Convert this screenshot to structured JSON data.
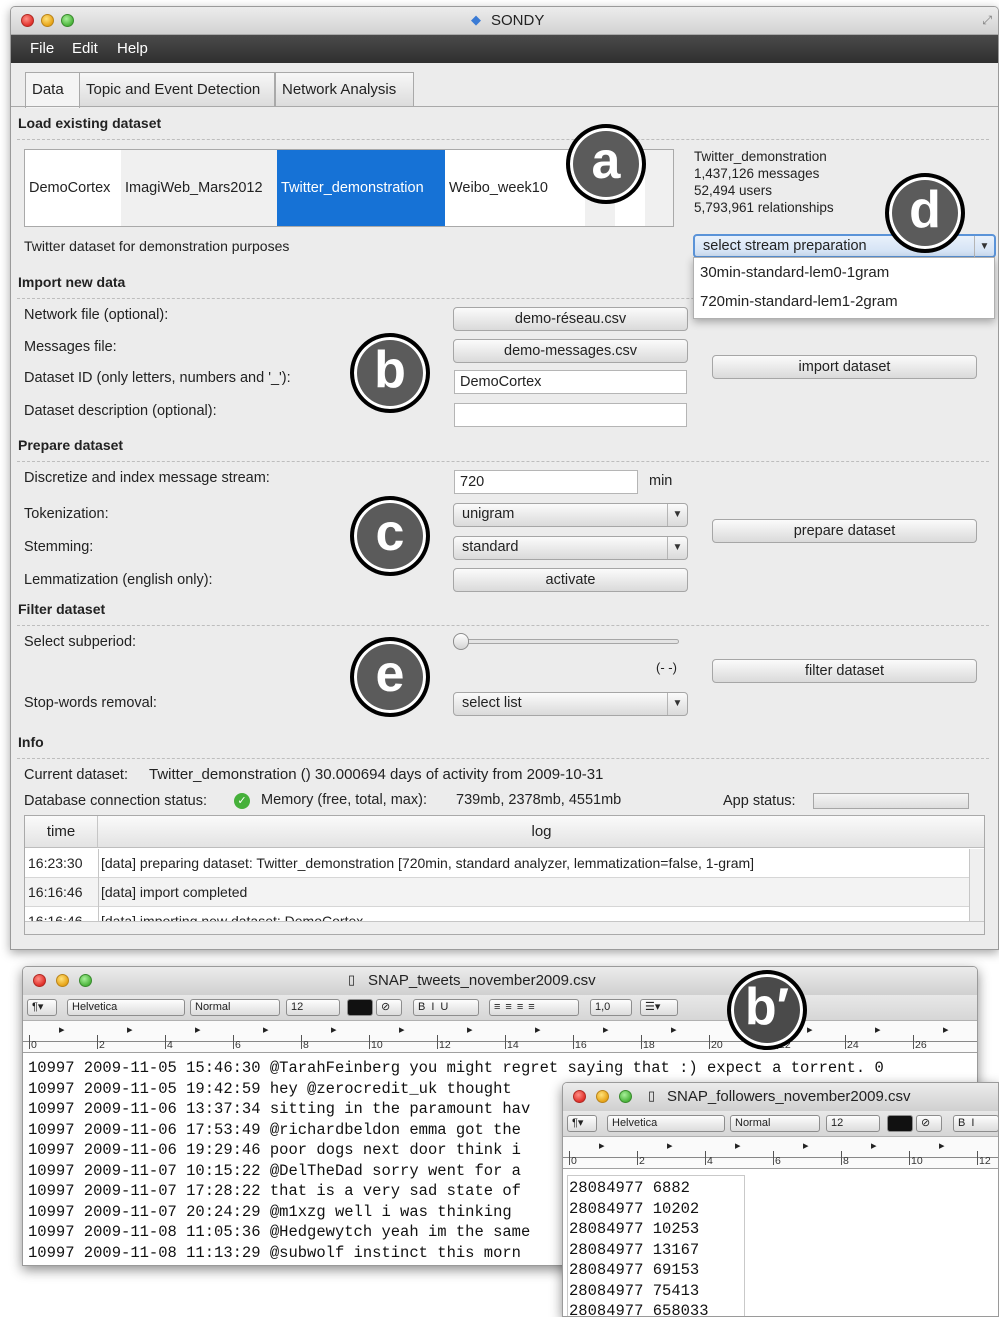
{
  "window": {
    "title": "SONDY"
  },
  "menu": [
    "File",
    "Edit",
    "Help"
  ],
  "tabs": [
    "Data",
    "Topic and Event Detection",
    "Network Analysis"
  ],
  "load": {
    "section": "Load existing dataset",
    "datasets": [
      "DemoCortex",
      "ImagiWeb_Mars2012",
      "Twitter_demonstration",
      "Weibo_week10"
    ],
    "selected": "Twitter_demonstration",
    "description": "Twitter dataset for demonstration purposes",
    "info": [
      "Twitter_demonstration",
      "1,437,126 messages",
      "52,494 users",
      "5,793,961 relationships"
    ],
    "stream_select": "select stream preparation",
    "stream_options": [
      "30min-standard-lem0-1gram",
      "720min-standard-lem1-2gram"
    ]
  },
  "import": {
    "section": "Import new data",
    "network_label": "Network file (optional):",
    "network_button": "demo-réseau.csv",
    "messages_label": "Messages file:",
    "messages_button": "demo-messages.csv",
    "id_label": "Dataset ID (only letters, numbers and '_'):",
    "id_value": "DemoCortex",
    "desc_label": "Dataset description (optional):",
    "desc_value": "",
    "import_button": "import dataset"
  },
  "prepare": {
    "section": "Prepare dataset",
    "discretize_label": "Discretize and index message stream:",
    "discretize_value": "720",
    "unit": "min",
    "token_label": "Tokenization:",
    "token_value": "unigram",
    "stem_label": "Stemming:",
    "stem_value": "standard",
    "lemma_label": "Lemmatization (english only):",
    "lemma_button": "activate",
    "prepare_button": "prepare dataset"
  },
  "filter": {
    "section": "Filter dataset",
    "subperiod_label": "Select subperiod:",
    "range": "(- -)",
    "stopwords_label": "Stop-words removal:",
    "stopwords_value": "select list",
    "filter_button": "filter dataset"
  },
  "info": {
    "section": "Info",
    "current_label": "Current dataset:",
    "current_value": "Twitter_demonstration () 30.000694 days of activity from 2009-10-31",
    "db_label": "Database connection status:",
    "memory_label": "Memory (free, total, max):",
    "memory_value": "739mb, 2378mb, 4551mb",
    "app_status_label": "App status:"
  },
  "log": {
    "headers": [
      "time",
      "log"
    ],
    "rows": [
      {
        "time": "16:23:30",
        "msg": "[data] preparing dataset: Twitter_demonstration [720min, standard analyzer, lemmatization=false, 1-gram]"
      },
      {
        "time": "16:16:46",
        "msg": "[data] import completed"
      },
      {
        "time": "16:16:46",
        "msg": "[data] importing new dataset: DemoCortex"
      }
    ]
  },
  "callouts": [
    "a",
    "b",
    "c",
    "d",
    "e",
    "b′"
  ],
  "editor1": {
    "title": "SNAP_tweets_november2009.csv",
    "font": "Helvetica",
    "style": "Normal",
    "size": "12",
    "spacing": "1,0",
    "ruler": [
      "0",
      "2",
      "4",
      "6",
      "8",
      "10",
      "12",
      "14",
      "16",
      "18",
      "20",
      "22",
      "24",
      "26"
    ],
    "lines": [
      "10997   2009-11-05 15:46:30 @TarahFeinberg you might regret saying that :)  expect a torrent. 0",
      "10997   2009-11-05 19:42:59 hey @zerocredit_uk  thought",
      "10997   2009-11-06 13:37:34 sitting in the paramount hav",
      "10997   2009-11-06 17:53:49 @richardbeldon emma got the",
      "10997   2009-11-06 19:29:46 poor dogs next door think i",
      "10997   2009-11-07 10:15:22 @DelTheDad sorry went for a",
      "10997   2009-11-07 17:28:22 that is a very sad state of",
      "10997   2009-11-07 20:24:29 @m1xzg well i was thinking",
      "10997   2009-11-08 11:05:36 @Hedgewytch yeah im the same",
      "10997   2009-11-08 11:13:29 @subwolf instinct this morn"
    ]
  },
  "editor2": {
    "title": "SNAP_followers_november2009.csv",
    "font": "Helvetica",
    "style": "Normal",
    "size": "12",
    "ruler": [
      "0",
      "2",
      "4",
      "6",
      "8",
      "10",
      "12"
    ],
    "lines": [
      "28084977 6882",
      "28084977 10202",
      "28084977 10253",
      "28084977 13167",
      "28084977 69153",
      "28084977 75413",
      "28084977 658033"
    ]
  }
}
